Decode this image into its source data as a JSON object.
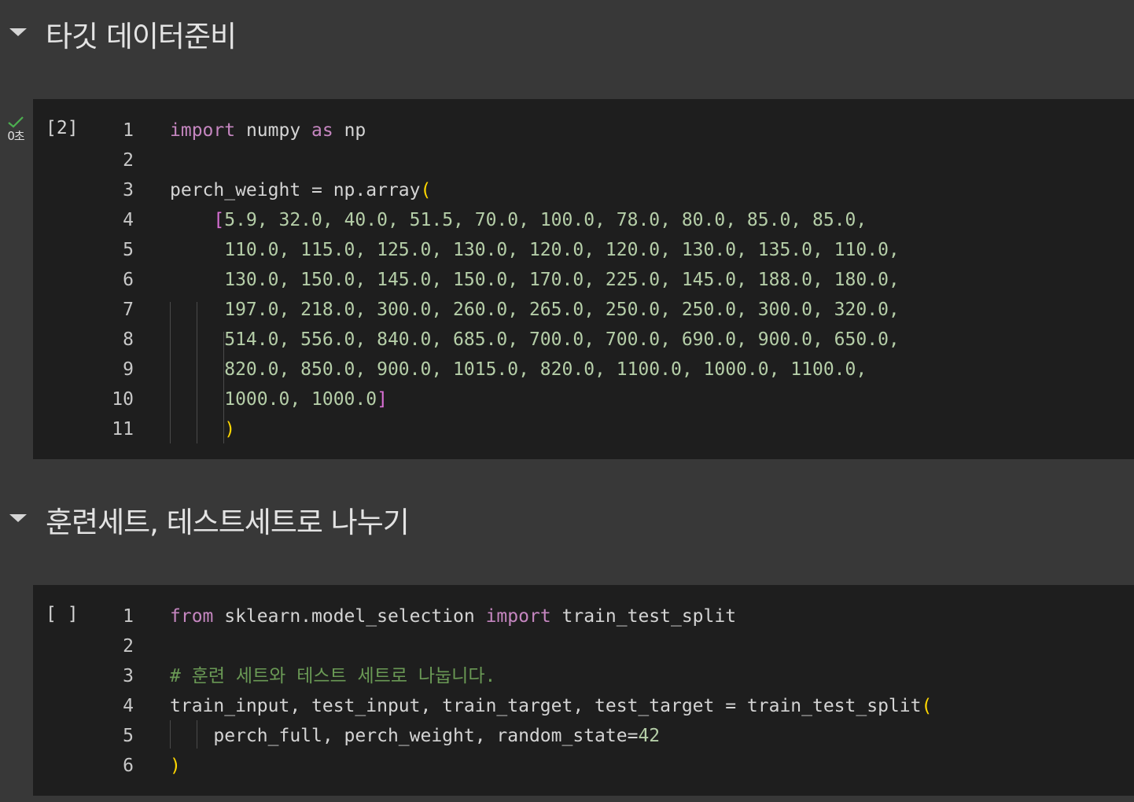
{
  "sections": [
    {
      "title": "타깃 데이터준비",
      "cell": {
        "exec_count": "[2]",
        "status": "success",
        "exec_time": "0초",
        "line_numbers": [
          "1",
          "2",
          "3",
          "4",
          "5",
          "6",
          "7",
          "8",
          "9",
          "10",
          "11"
        ],
        "code_lines": [
          [
            {
              "t": "import",
              "c": "kw"
            },
            {
              "t": " numpy ",
              "c": "plain"
            },
            {
              "t": "as",
              "c": "kw"
            },
            {
              "t": " np",
              "c": "plain"
            }
          ],
          [],
          [
            {
              "t": "perch_weight = np.array",
              "c": "plain"
            },
            {
              "t": "(",
              "c": "paren"
            }
          ],
          [
            {
              "t": "    ",
              "c": "plain"
            },
            {
              "t": "[",
              "c": "bracket"
            },
            {
              "t": "5.9, 32.0, 40.0, 51.5, 70.0, 100.0, 78.0, 80.0, 85.0, 85.0,",
              "c": "num"
            }
          ],
          [
            {
              "t": "     110.0, 115.0, 125.0, 130.0, 120.0, 120.0, 130.0, 135.0, 110.0,",
              "c": "num"
            }
          ],
          [
            {
              "t": "     130.0, 150.0, 145.0, 150.0, 170.0, 225.0, 145.0, 188.0, 180.0,",
              "c": "num"
            }
          ],
          [
            {
              "t": "     197.0, 218.0, 300.0, 260.0, 265.0, 250.0, 250.0, 300.0, 320.0,",
              "c": "num"
            }
          ],
          [
            {
              "t": "     514.0, 556.0, 840.0, 685.0, 700.0, 700.0, 690.0, 900.0, 650.0,",
              "c": "num"
            }
          ],
          [
            {
              "t": "     820.0, 850.0, 900.0, 1015.0, 820.0, 1100.0, 1000.0, 1100.0,",
              "c": "num"
            }
          ],
          [
            {
              "t": "     1000.0, 1000.0",
              "c": "num"
            },
            {
              "t": "]",
              "c": "bracket"
            }
          ],
          [
            {
              "t": "     ",
              "c": "plain"
            },
            {
              "t": ")",
              "c": "paren"
            }
          ]
        ]
      }
    },
    {
      "title": "훈련세트, 테스트세트로 나누기",
      "cell": {
        "exec_count": "[ ]",
        "status": "not-run",
        "exec_time": "",
        "line_numbers": [
          "1",
          "2",
          "3",
          "4",
          "5",
          "6"
        ],
        "code_lines": [
          [
            {
              "t": "from",
              "c": "kw"
            },
            {
              "t": " sklearn.model_selection ",
              "c": "plain"
            },
            {
              "t": "import",
              "c": "kw"
            },
            {
              "t": " train_test_split",
              "c": "plain"
            }
          ],
          [],
          [
            {
              "t": "# 훈련 세트와 테스트 세트로 나눕니다.",
              "c": "cmt"
            }
          ],
          [
            {
              "t": "train_input, test_input, train_target, test_target = train_test_split",
              "c": "plain"
            },
            {
              "t": "(",
              "c": "paren"
            }
          ],
          [
            {
              "t": "    perch_full, perch_weight, random_state=",
              "c": "plain"
            },
            {
              "t": "42",
              "c": "num"
            }
          ],
          [
            {
              "t": ")",
              "c": "paren"
            }
          ]
        ]
      }
    }
  ],
  "colors": {
    "background": "#383838",
    "cell_background": "#1e1e1e",
    "keyword": "#c586c0",
    "number": "#b5cea8",
    "paren": "#ffd700",
    "bracket": "#da70d6",
    "comment": "#6a9955",
    "success_check": "#4caf50"
  },
  "icons": {
    "collapse": "caret-down-icon",
    "status_ok": "check-icon"
  }
}
